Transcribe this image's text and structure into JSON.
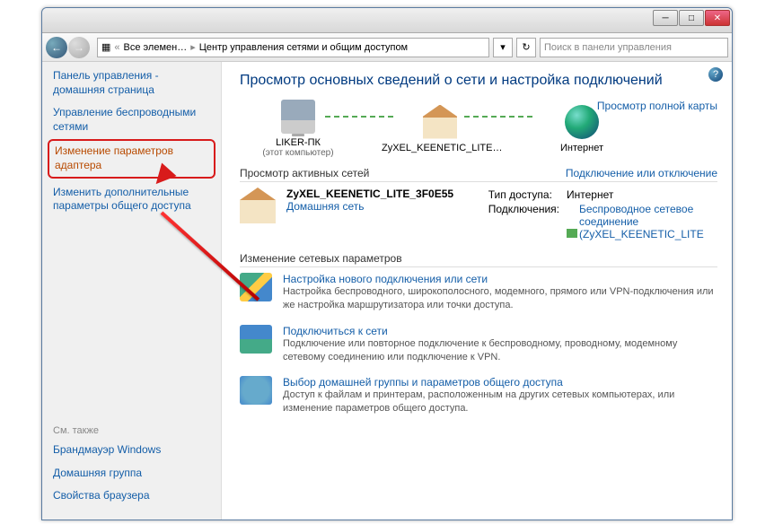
{
  "breadcrumb": {
    "icon": "cp",
    "root": "Все элемен…",
    "page": "Центр управления сетями и общим доступом"
  },
  "search": {
    "placeholder": "Поиск в панели управления"
  },
  "sidebar": {
    "home": "Панель управления - домашняя страница",
    "links": [
      "Управление беспроводными сетями",
      "Изменение параметров адаптера",
      "Изменить дополнительные параметры общего доступа"
    ],
    "also_label": "См. также",
    "also": [
      "Брандмауэр Windows",
      "Домашняя группа",
      "Свойства браузера"
    ]
  },
  "main": {
    "heading": "Просмотр основных сведений о сети и настройка подключений",
    "full_map": "Просмотр полной карты",
    "map": {
      "pc": "LIKER-ПК",
      "pc_sub": "(этот компьютер)",
      "router": "ZyXEL_KEENETIC_LITE…",
      "internet": "Интернет"
    },
    "active_head": "Просмотр активных сетей",
    "active_link": "Подключение или отключение",
    "active": {
      "name": "ZyXEL_KEENETIC_LITE_3F0E55",
      "type_link": "Домашняя сеть",
      "access_label": "Тип доступа:",
      "access_value": "Интернет",
      "conn_label": "Подключения:",
      "conn_value": "Беспроводное сетевое соединение (ZyXEL_KEENETIC_LITE"
    },
    "change_head": "Изменение сетевых параметров",
    "tasks": [
      {
        "title": "Настройка нового подключения или сети",
        "desc": "Настройка беспроводного, широкополосного, модемного, прямого или VPN-подключения или же настройка маршрутизатора или точки доступа."
      },
      {
        "title": "Подключиться к сети",
        "desc": "Подключение или повторное подключение к беспроводному, проводному, модемному сетевому соединению или подключение к VPN."
      },
      {
        "title": "Выбор домашней группы и параметров общего доступа",
        "desc": "Доступ к файлам и принтерам, расположенным на других сетевых компьютерах, или изменение параметров общего доступа."
      }
    ]
  }
}
